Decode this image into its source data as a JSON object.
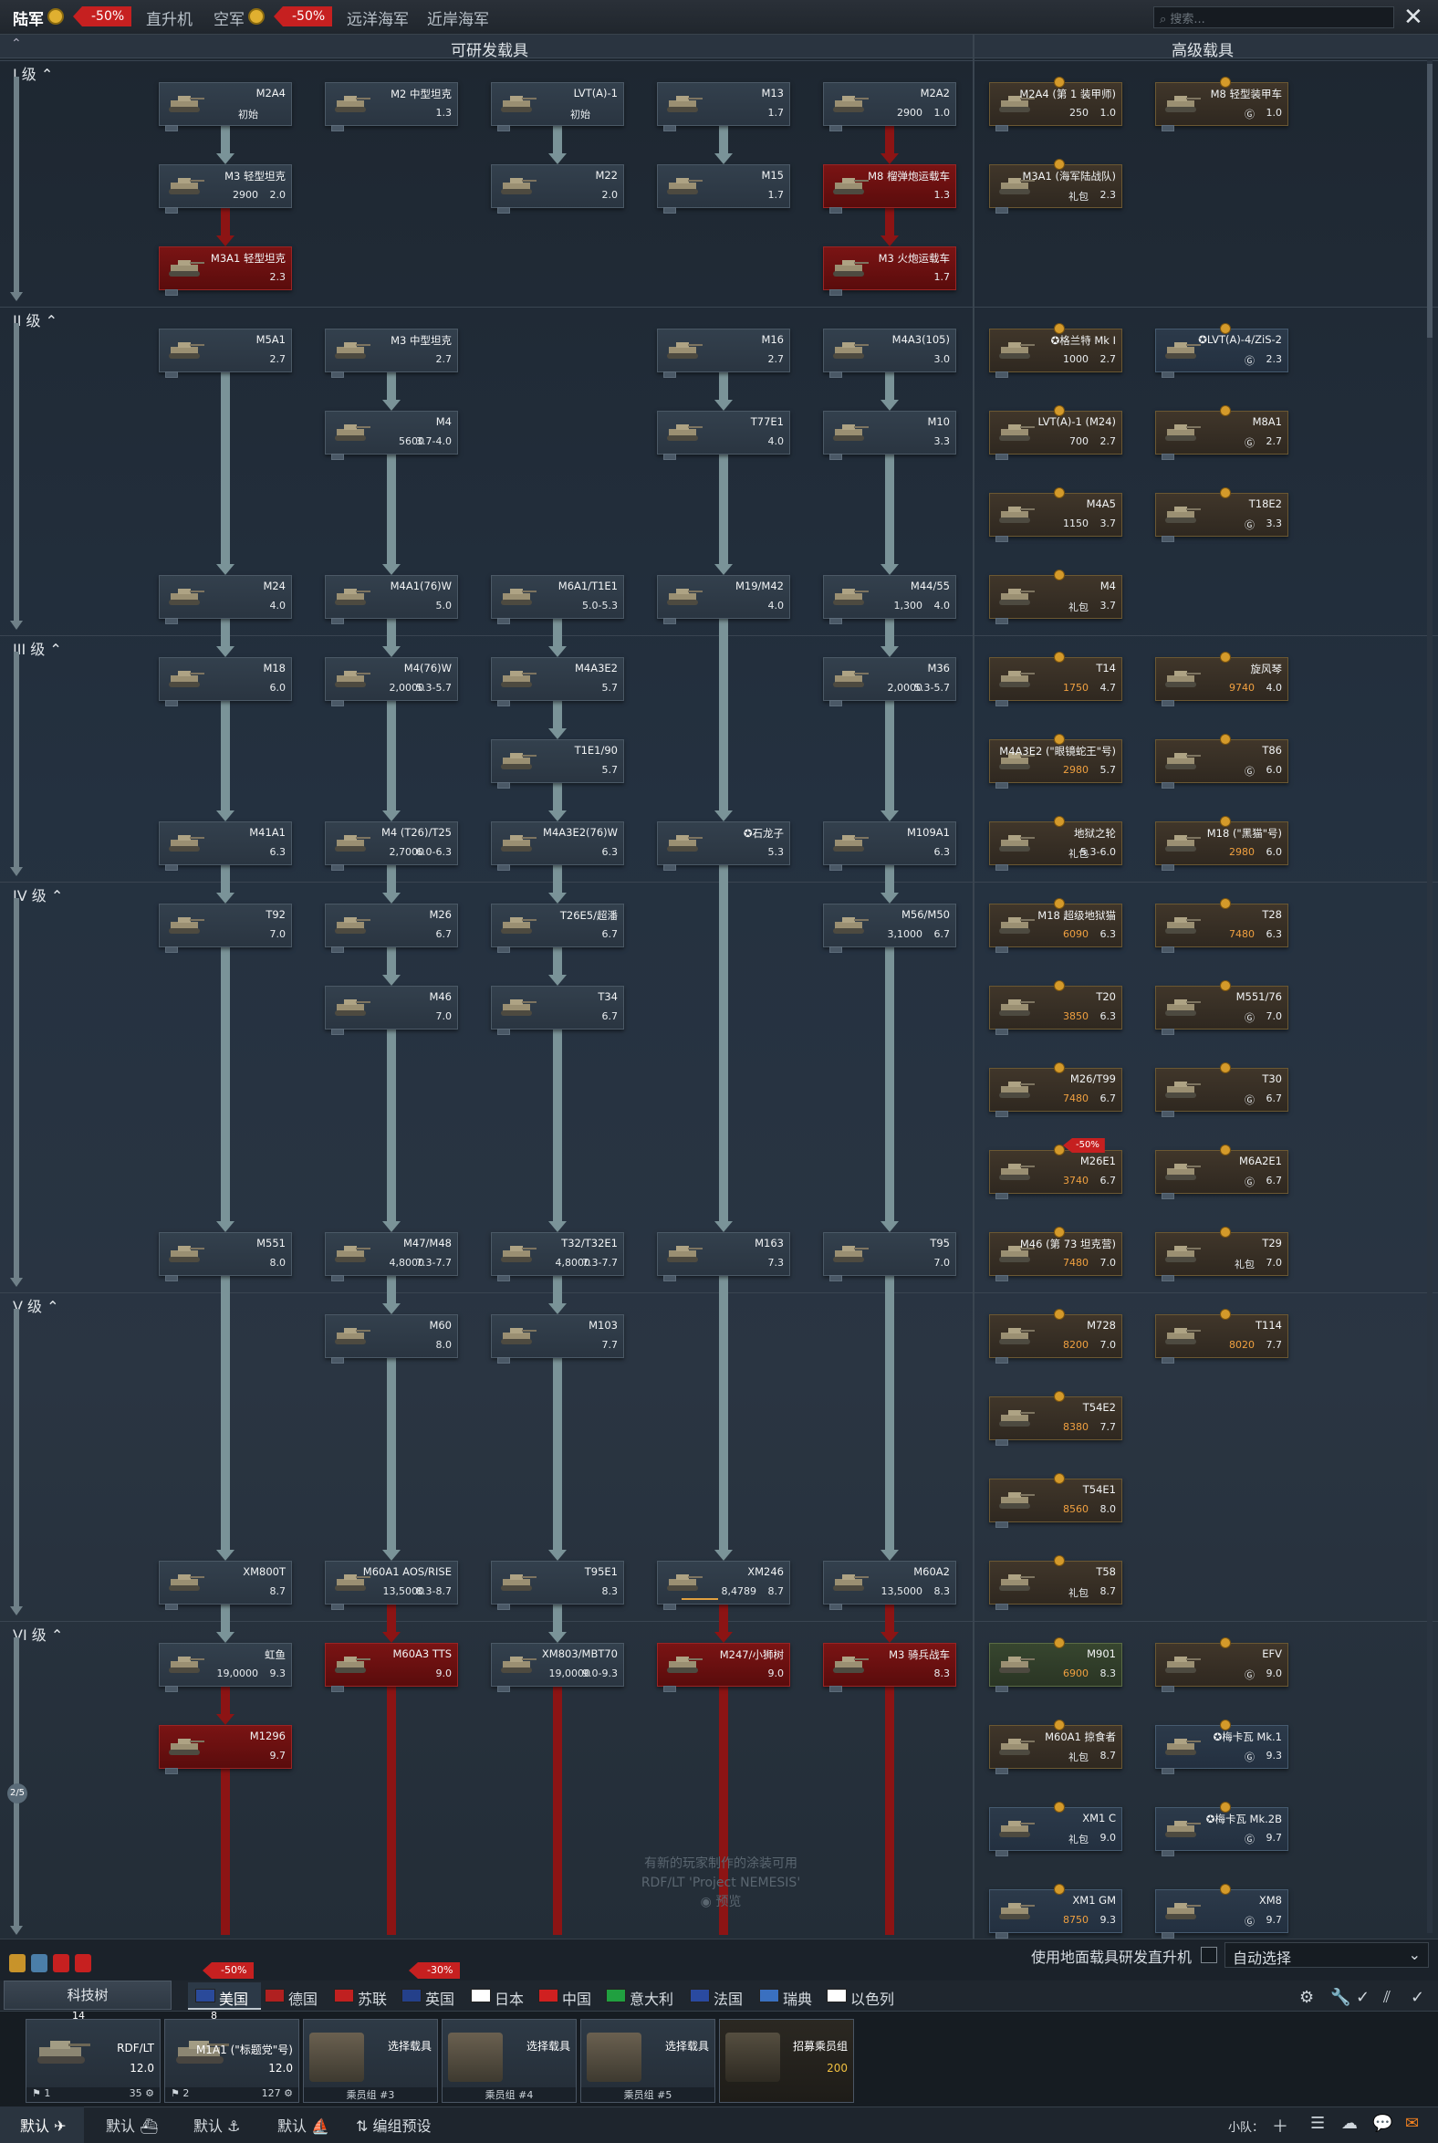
{
  "top": {
    "tabs": [
      "陆军",
      "直升机",
      "空军",
      "远洋海军",
      "近岸海军"
    ],
    "disc1": "-50%",
    "disc2": "-50%",
    "search_placeholder": "搜索..."
  },
  "header": {
    "left": "可研发载具",
    "right": "高级载具"
  },
  "ranks": [
    "I 级",
    "II 级",
    "III 级",
    "IV 级",
    "V 级",
    "VI 级"
  ],
  "tree": [
    {
      "n": "M2A4",
      "c": "初始",
      "b": "",
      "k": "n"
    },
    {
      "n": "M2 中型坦克",
      "b": "1.3",
      "k": "n"
    },
    {
      "n": "LVT(A)-1",
      "c": "初始",
      "b": "",
      "k": "n"
    },
    {
      "n": "M13",
      "b": "1.7",
      "k": "n"
    },
    {
      "n": "M2A2",
      "c": "2900",
      "b": "1.0",
      "k": "n"
    },
    {
      "n": "M3 轻型坦克",
      "c": "2900",
      "b": "2.0",
      "k": "n"
    },
    {
      "n": "M22",
      "b": "2.0",
      "k": "n"
    },
    {
      "n": "M15",
      "b": "1.7",
      "k": "n"
    },
    {
      "n": "M8 榴弹炮运载车",
      "b": "1.3",
      "k": "r"
    },
    {
      "n": "M3A1 轻型坦克",
      "b": "2.3",
      "k": "r"
    },
    {
      "n": "M3 火炮运载车",
      "b": "1.7",
      "k": "r"
    },
    {
      "n": "M5A1",
      "b": "2.7",
      "k": "n"
    },
    {
      "n": "M3 中型坦克",
      "b": "2.7",
      "k": "n"
    },
    {
      "n": "M16",
      "b": "2.7",
      "k": "n"
    },
    {
      "n": "M4A3(105)",
      "b": "3.0",
      "k": "n"
    },
    {
      "n": "M4",
      "c": "5600",
      "b": "3.7-4.0",
      "k": "n"
    },
    {
      "n": "T77E1",
      "b": "4.0",
      "k": "n"
    },
    {
      "n": "M10",
      "b": "3.3",
      "k": "n"
    },
    {
      "n": "M24",
      "b": "4.0",
      "k": "n"
    },
    {
      "n": "M4A1(76)W",
      "b": "5.0",
      "k": "n"
    },
    {
      "n": "M6A1/T1E1",
      "b": "5.0-5.3",
      "k": "n"
    },
    {
      "n": "M19/M42",
      "b": "4.0",
      "k": "n"
    },
    {
      "n": "M44/55",
      "c": "1,300",
      "b": "4.0",
      "k": "n"
    },
    {
      "n": "M18",
      "b": "6.0",
      "k": "n"
    },
    {
      "n": "M4(76)W",
      "c": "2,0000",
      "b": "5.3-5.7",
      "k": "n"
    },
    {
      "n": "M4A3E2",
      "b": "5.7",
      "k": "n"
    },
    {
      "n": "M36",
      "c": "2,0000",
      "b": "5.3-5.7",
      "k": "n"
    },
    {
      "n": "T1E1/90",
      "b": "5.7",
      "k": "n"
    },
    {
      "n": "M41A1",
      "b": "6.3",
      "k": "n"
    },
    {
      "n": "M4 (T26)/T25",
      "c": "2,7000",
      "b": "6.0-6.3",
      "k": "n"
    },
    {
      "n": "M4A3E2(76)W",
      "b": "6.3",
      "k": "n"
    },
    {
      "n": "✪石龙子",
      "b": "5.3",
      "k": "n"
    },
    {
      "n": "M109A1",
      "b": "6.3",
      "k": "n"
    },
    {
      "n": "T92",
      "b": "7.0",
      "k": "n"
    },
    {
      "n": "M26",
      "b": "6.7",
      "k": "n"
    },
    {
      "n": "T26E5/超潘",
      "b": "6.7",
      "k": "n"
    },
    {
      "n": "M56/M50",
      "c": "3,1000",
      "b": "6.7",
      "k": "n"
    },
    {
      "n": "M46",
      "b": "7.0",
      "k": "n"
    },
    {
      "n": "T34",
      "b": "6.7",
      "k": "n"
    },
    {
      "n": "M551",
      "b": "8.0",
      "k": "n"
    },
    {
      "n": "M47/M48",
      "c": "4,8000",
      "b": "7.3-7.7",
      "k": "n"
    },
    {
      "n": "T32/T32E1",
      "c": "4,8000",
      "b": "7.3-7.7",
      "k": "n"
    },
    {
      "n": "M163",
      "b": "7.3",
      "k": "n"
    },
    {
      "n": "T95",
      "b": "7.0",
      "k": "n"
    },
    {
      "n": "M60",
      "b": "8.0",
      "k": "n"
    },
    {
      "n": "M103",
      "b": "7.7",
      "k": "n"
    },
    {
      "n": "XM800T",
      "b": "8.7",
      "k": "n"
    },
    {
      "n": "M60A1 AOS/RISE",
      "c": "13,5000",
      "b": "8.3-8.7",
      "k": "n"
    },
    {
      "n": "T95E1",
      "b": "8.3",
      "k": "n"
    },
    {
      "n": "XM246",
      "c": "8,4789",
      "b": "8.7",
      "k": "n"
    },
    {
      "n": "M60A2",
      "c": "13,5000",
      "b": "8.3",
      "k": "n"
    },
    {
      "n": "虹鱼",
      "c": "19,0000",
      "b": "9.3",
      "k": "n"
    },
    {
      "n": "M60A3 TTS",
      "b": "9.0",
      "k": "r"
    },
    {
      "n": "XM803/MBT70",
      "c": "19,0000",
      "b": "9.0-9.3",
      "k": "n"
    },
    {
      "n": "M247/小狮树",
      "b": "9.0",
      "k": "r"
    },
    {
      "n": "M3 骑兵战车",
      "b": "8.3",
      "k": "r"
    },
    {
      "n": "M1296",
      "b": "9.7",
      "k": "r"
    }
  ],
  "premium": [
    {
      "n": "M2A4 (第 1 装甲师)",
      "c": "250",
      "b": "1.0"
    },
    {
      "n": "M8 轻型装甲车",
      "c": "Ⓖ",
      "b": "1.0"
    },
    {
      "n": "M3A1 (海军陆战队)",
      "c": "礼包",
      "b": "2.3"
    },
    {
      "n": "✪格兰特 Mk I",
      "c": "1000",
      "b": "2.7"
    },
    {
      "n": "✪LVT(A)-4/ZiS-2",
      "c": "Ⓖ",
      "b": "2.3"
    },
    {
      "n": "LVT(A)-1 (M24)",
      "c": "700",
      "b": "2.7"
    },
    {
      "n": "M8A1",
      "c": "Ⓖ",
      "b": "2.7"
    },
    {
      "n": "M4A5",
      "c": "1150",
      "b": "3.7"
    },
    {
      "n": "T18E2",
      "c": "Ⓖ",
      "b": "3.3"
    },
    {
      "n": "M4",
      "c": "礼包",
      "b": "3.7"
    },
    {
      "n": "T14",
      "c": "1750",
      "b": "4.7"
    },
    {
      "n": "旋风琴",
      "c": "9740",
      "b": "4.0"
    },
    {
      "n": "M4A3E2 (\"眼镜蛇王\"号)",
      "c": "2980",
      "b": "5.7"
    },
    {
      "n": "T86",
      "c": "Ⓖ",
      "b": "6.0"
    },
    {
      "n": "地狱之轮",
      "c": "礼包",
      "b": "5.3-6.0"
    },
    {
      "n": "M18 (\"黑猫\"号)",
      "c": "2980",
      "b": "6.0"
    },
    {
      "n": "M18 超级地狱猫",
      "c": "6090",
      "b": "6.3"
    },
    {
      "n": "T28",
      "c": "7480",
      "b": "6.3"
    },
    {
      "n": "T20",
      "c": "3850",
      "b": "6.3"
    },
    {
      "n": "M551/76",
      "c": "Ⓖ",
      "b": "7.0"
    },
    {
      "n": "M26/T99",
      "c": "7480",
      "b": "6.7"
    },
    {
      "n": "T30",
      "c": "Ⓖ",
      "b": "6.7"
    },
    {
      "n": "M26E1",
      "c": "3740",
      "b": "6.7"
    },
    {
      "n": "M6A2E1",
      "c": "Ⓖ",
      "b": "6.7"
    },
    {
      "n": "M46 (第 73 坦克营)",
      "c": "7480",
      "b": "7.0"
    },
    {
      "n": "T29",
      "c": "礼包",
      "b": "7.0"
    },
    {
      "n": "M728",
      "c": "8200",
      "b": "7.0"
    },
    {
      "n": "T114",
      "c": "8020",
      "b": "7.7"
    },
    {
      "n": "T54E2",
      "c": "8380",
      "b": "7.7"
    },
    {
      "n": "T54E1",
      "c": "8560",
      "b": "8.0"
    },
    {
      "n": "T58",
      "c": "礼包",
      "b": "8.7"
    },
    {
      "n": "M901",
      "c": "6900",
      "b": "8.3"
    },
    {
      "n": "EFV",
      "c": "Ⓖ",
      "b": "9.0"
    },
    {
      "n": "M60A1 掠食者",
      "c": "礼包",
      "b": "8.7"
    },
    {
      "n": "✪梅卡瓦 Mk.1",
      "c": "Ⓖ",
      "b": "9.3"
    },
    {
      "n": "XM1 C",
      "c": "礼包",
      "b": "9.0"
    },
    {
      "n": "✪梅卡瓦 Mk.2B",
      "c": "Ⓖ",
      "b": "9.7"
    },
    {
      "n": "XM1 GM",
      "c": "8750",
      "b": "9.3"
    },
    {
      "n": "XM8",
      "c": "Ⓖ",
      "b": "9.7"
    }
  ],
  "m26e1_disc": "-50%",
  "watermark": [
    "有新的玩家制作的涂装可用",
    "RDF/LT 'Project NEMESIS'",
    "预览"
  ],
  "helicopter_label": "使用地面载具研发直升机",
  "auto_select": "自动选择",
  "techtree_label": "科技树",
  "nations": [
    "美国",
    "德国",
    "苏联",
    "英国",
    "日本",
    "中国",
    "意大利",
    "法国",
    "瑞典",
    "以色列"
  ],
  "nation_disc1": "-50%",
  "nation_disc2": "-30%",
  "slots": [
    {
      "name": "RDF/LT",
      "br": "12.0",
      "top": "14",
      "foot_l": "1",
      "foot_r": "35"
    },
    {
      "name": "M1A1 (\"标题党\"号)",
      "br": "12.0",
      "top": "8",
      "foot_l": "2",
      "foot_r": "127"
    },
    {
      "name": "选择载具",
      "foot": "乘员组 #3"
    },
    {
      "name": "选择载具",
      "foot": "乘员组 #4"
    },
    {
      "name": "选择载具",
      "foot": "乘员组 #5"
    },
    {
      "name": "招募乘员组",
      "br": "200"
    }
  ],
  "bottom": {
    "tabs": [
      "默认",
      "默认",
      "默认",
      "默认",
      "编组预设"
    ],
    "squad": "小队："
  },
  "page": "2/5"
}
